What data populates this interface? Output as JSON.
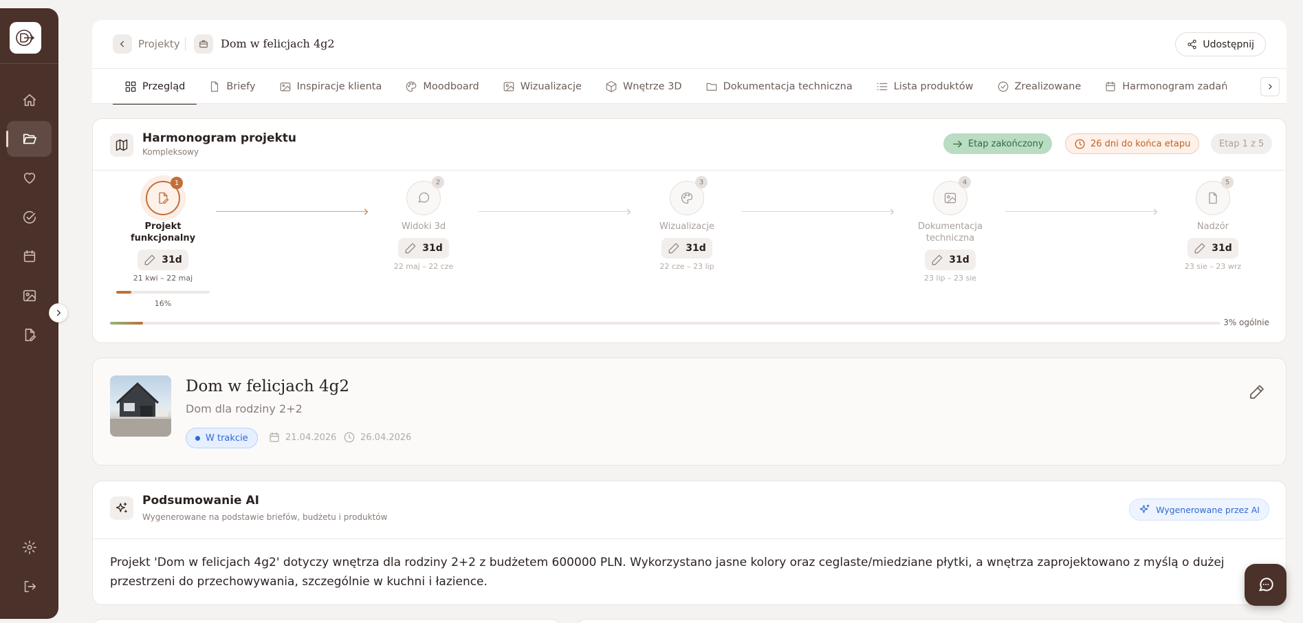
{
  "sidebar": {
    "logo_icon": "brand-logo-icon",
    "items": [
      {
        "icon": "home-icon",
        "active": false
      },
      {
        "icon": "folder-open-icon",
        "active": true
      },
      {
        "icon": "heart-icon",
        "active": false
      },
      {
        "icon": "check-circle-icon",
        "active": false
      },
      {
        "icon": "calendar-icon",
        "active": false
      },
      {
        "icon": "image-icon",
        "active": false
      },
      {
        "icon": "document-edit-icon",
        "active": false
      }
    ],
    "bottom": [
      {
        "icon": "settings-icon"
      },
      {
        "icon": "logout-icon"
      }
    ]
  },
  "header": {
    "back_label": "Projekty",
    "project_title": "Dom w felicjach 4g2",
    "share_label": "Udostępnij"
  },
  "tabs": [
    {
      "label": "Przegląd",
      "icon": "grid-icon",
      "active": true
    },
    {
      "label": "Briefy",
      "icon": "file-icon",
      "active": false
    },
    {
      "label": "Inspiracje klienta",
      "icon": "images-icon",
      "active": false
    },
    {
      "label": "Moodboard",
      "icon": "palette-icon",
      "active": false
    },
    {
      "label": "Wizualizacje",
      "icon": "image-icon",
      "active": false
    },
    {
      "label": "Wnętrze 3D",
      "icon": "cube-icon",
      "active": false
    },
    {
      "label": "Dokumentacja techniczna",
      "icon": "folder-icon",
      "active": false
    },
    {
      "label": "Lista produktów",
      "icon": "list-icon",
      "active": false
    },
    {
      "label": "Zrealizowane",
      "icon": "check-circle-icon",
      "active": false
    },
    {
      "label": "Harmonogram zadań",
      "icon": "calendar-icon",
      "active": false
    }
  ],
  "schedule": {
    "title": "Harmonogram projektu",
    "subtitle": "Kompleksowy",
    "status_done": "Etap zakończony",
    "days_left": "26 dni do końca etapu",
    "stage_counter": "Etap 1 z 5",
    "stages": [
      {
        "num": "1",
        "name": "Projekt funkcjonalny",
        "duration": "31d",
        "dates": "21 kwi – 22 maj",
        "progress_pct": 16,
        "progress_label": "16%",
        "active": true
      },
      {
        "num": "2",
        "name": "Widoki 3d",
        "duration": "31d",
        "dates": "22 maj – 22 cze",
        "active": false
      },
      {
        "num": "3",
        "name": "Wizualizacje",
        "duration": "31d",
        "dates": "22 cze – 23 lip",
        "active": false
      },
      {
        "num": "4",
        "name": "Dokumentacja techniczna",
        "duration": "31d",
        "dates": "23 lip – 23 sie",
        "active": false
      },
      {
        "num": "5",
        "name": "Nadzór",
        "duration": "31d",
        "dates": "23 sie – 23 wrz",
        "active": false
      }
    ],
    "overall_pct": 3,
    "overall_label": "3% ogólnie"
  },
  "project": {
    "title": "Dom w felicjach 4g2",
    "subtitle": "Dom dla rodziny 2+2",
    "status": "W trakcie",
    "start_date": "21.04.2026",
    "end_date": "26.04.2026"
  },
  "ai_summary": {
    "title": "Podsumowanie AI",
    "subtitle": "Wygenerowane na podstawie briefów, budżetu i produktów",
    "badge": "Wygenerowane przez AI",
    "text": "Projekt 'Dom w felicjach 4g2' dotyczy wnętrza dla rodziny 2+2 z budżetem 600000 PLN. Wykorzystano jasne kolory oraz ceglaste/miedziane płytki, a wnętrza zaprojektowano z myślą o dużej przestrzeni do przechowywania, szczególnie w kuchni i łazience."
  },
  "colors": {
    "sidebar_bg": "#4a3129",
    "accent": "#c0703a",
    "success": "#2f6b43",
    "info": "#2f6ad0"
  }
}
